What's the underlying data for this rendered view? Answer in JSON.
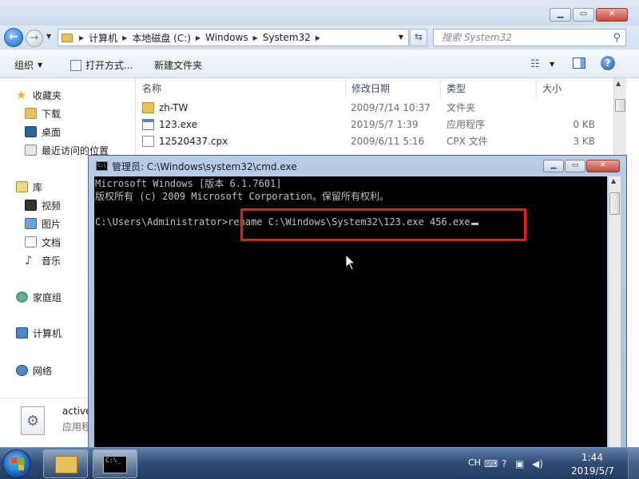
{
  "explorer": {
    "address": {
      "crumbs": [
        "计算机",
        "本地磁盘 (C:)",
        "Windows",
        "System32"
      ]
    },
    "search_placeholder": "搜索 System32",
    "toolbar": {
      "organize": "组织",
      "open_with": "打开方式...",
      "new_folder": "新建文件夹"
    },
    "nav": {
      "favorites": "收藏夹",
      "downloads": "下载",
      "desktop": "桌面",
      "recent": "最近访问的位置",
      "libraries": "库",
      "videos": "视频",
      "pictures": "图片",
      "documents": "文档",
      "music": "音乐",
      "homegroup": "家庭组",
      "computer": "计算机",
      "network": "网络"
    },
    "columns": {
      "name": "名称",
      "date": "修改日期",
      "type": "类型",
      "size": "大小"
    },
    "files": [
      {
        "name": "zh-TW",
        "date": "2009/7/14 10:37",
        "type": "文件夹",
        "size": ""
      },
      {
        "name": "123.exe",
        "date": "2019/5/7 1:39",
        "type": "应用程序",
        "size": "0 KB"
      },
      {
        "name": "12520437.cpx",
        "date": "2009/6/11 5:16",
        "type": "CPX 文件",
        "size": "3 KB"
      }
    ],
    "details": {
      "name": "active",
      "type": "应用程"
    }
  },
  "cmd": {
    "title": "管理员: C:\\Windows\\system32\\cmd.exe",
    "lines": [
      "Microsoft Windows [版本 6.1.7601]",
      "版权所有 (c) 2009 Microsoft Corporation。保留所有权利。",
      "",
      "C:\\Users\\Administrator>rename C:\\Windows\\System32\\123.exe 456.exe"
    ]
  },
  "taskbar": {
    "lang": "CH",
    "time": "1:44",
    "date": "2019/5/7"
  },
  "colors": {
    "highlight_box": "#e81e1e",
    "console_bg": "#000000",
    "console_text": "#c0c0c0"
  }
}
